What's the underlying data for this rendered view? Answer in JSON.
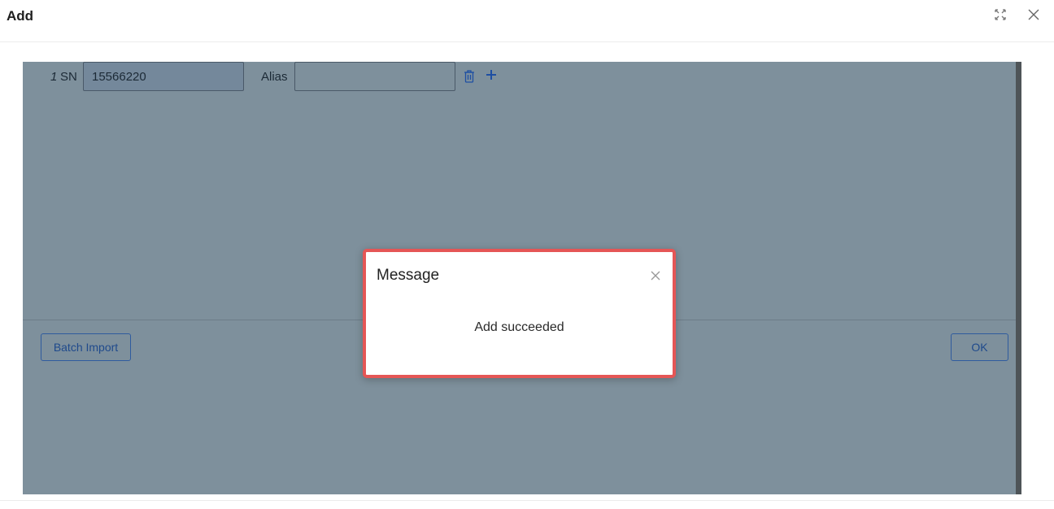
{
  "dialog": {
    "title": "Add"
  },
  "header_icons": {
    "maximize": "maximize-icon",
    "close": "close-icon"
  },
  "rows": [
    {
      "index": "1",
      "sn_label": "SN",
      "sn_value": "15566220",
      "alias_label": "Alias",
      "alias_value": ""
    }
  ],
  "footer": {
    "batch_import_label": "Batch Import",
    "ok_label": "OK"
  },
  "message_box": {
    "title": "Message",
    "text": "Add succeeded"
  },
  "colors": {
    "overlay": "#7e909c",
    "accent": "#1f4a8c",
    "modal_border": "#e55656"
  }
}
